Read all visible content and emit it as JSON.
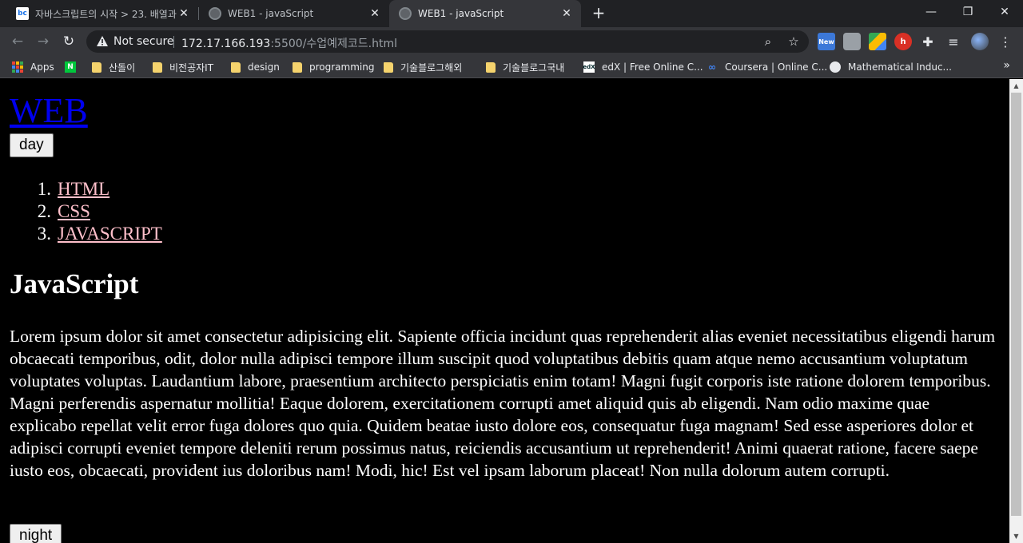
{
  "browser": {
    "tabs": [
      {
        "title": "자바스크립트의 시작 > 23. 배열과",
        "favicon": "bc-favicon-icon",
        "active": false
      },
      {
        "title": "WEB1 - javaScript",
        "favicon": "globe-icon",
        "active": false
      },
      {
        "title": "WEB1 - javaScript",
        "favicon": "globe-icon",
        "active": true
      }
    ],
    "new_tab_glyph": "+",
    "security_label": "Not secure",
    "url_host": "172.17.166.193",
    "url_rest": ":5500/수업예제코드.html",
    "extension_new_badge": "New",
    "bookmarks": [
      {
        "label": "Apps",
        "icon": "apps-grid-icon"
      },
      {
        "label": "",
        "icon": "naver-icon",
        "icon_text": "N"
      },
      {
        "label": "산돌이",
        "icon": "folder-icon"
      },
      {
        "label": "비전공자IT",
        "icon": "folder-icon"
      },
      {
        "label": "design",
        "icon": "folder-icon"
      },
      {
        "label": "programming",
        "icon": "folder-icon"
      },
      {
        "label": "기술블로그해외",
        "icon": "folder-icon"
      },
      {
        "label": "기술블로그국내",
        "icon": "folder-icon"
      },
      {
        "label": "edX | Free Online C...",
        "icon": "edx-icon",
        "icon_text": "edX"
      },
      {
        "label": "Coursera | Online C...",
        "icon": "coursera-icon",
        "icon_text": "∞"
      },
      {
        "label": "Mathematical Induc...",
        "icon": "globe-icon"
      }
    ],
    "bookmarks_more": "»"
  },
  "page": {
    "site_title": "WEB",
    "day_button": "day",
    "night_button": "night",
    "toc": [
      {
        "num": "1.",
        "label": "HTML"
      },
      {
        "num": "2.",
        "label": "CSS"
      },
      {
        "num": "3.",
        "label": "JAVASCRIPT"
      }
    ],
    "heading": "JavaScript",
    "body": "Lorem ipsum dolor sit amet consectetur adipisicing elit. Sapiente officia incidunt quas reprehenderit alias eveniet necessitatibus eligendi harum obcaecati temporibus, odit, dolor nulla adipisci tempore illum suscipit quod voluptatibus debitis quam atque nemo accusantium voluptatum voluptates voluptas. Laudantium labore, praesentium architecto perspiciatis enim totam! Magni fugit corporis iste ratione dolorem temporibus. Magni perferendis aspernatur mollitia! Eaque dolorem, exercitationem corrupti amet aliquid quis ab eligendi. Nam odio maxime quae explicabo repellat velit error fuga dolores quo quia. Quidem beatae iusto dolore eos, consequatur fuga magnam! Sed esse asperiores dolor et adipisci corrupti eveniet tempore deleniti rerum possimus natus, reiciendis accusantium ut reprehenderit! Animi quaerat ratione, facere saepe iusto eos, obcaecati, provident ius doloribus nam! Modi, hic! Est vel ipsam laborum placeat! Non nulla dolorum autem corrupti.",
    "colors": {
      "background": "#000000",
      "text": "#ffffff",
      "title_link": "#0000ee",
      "toc_link": "#ffc0cb"
    }
  }
}
